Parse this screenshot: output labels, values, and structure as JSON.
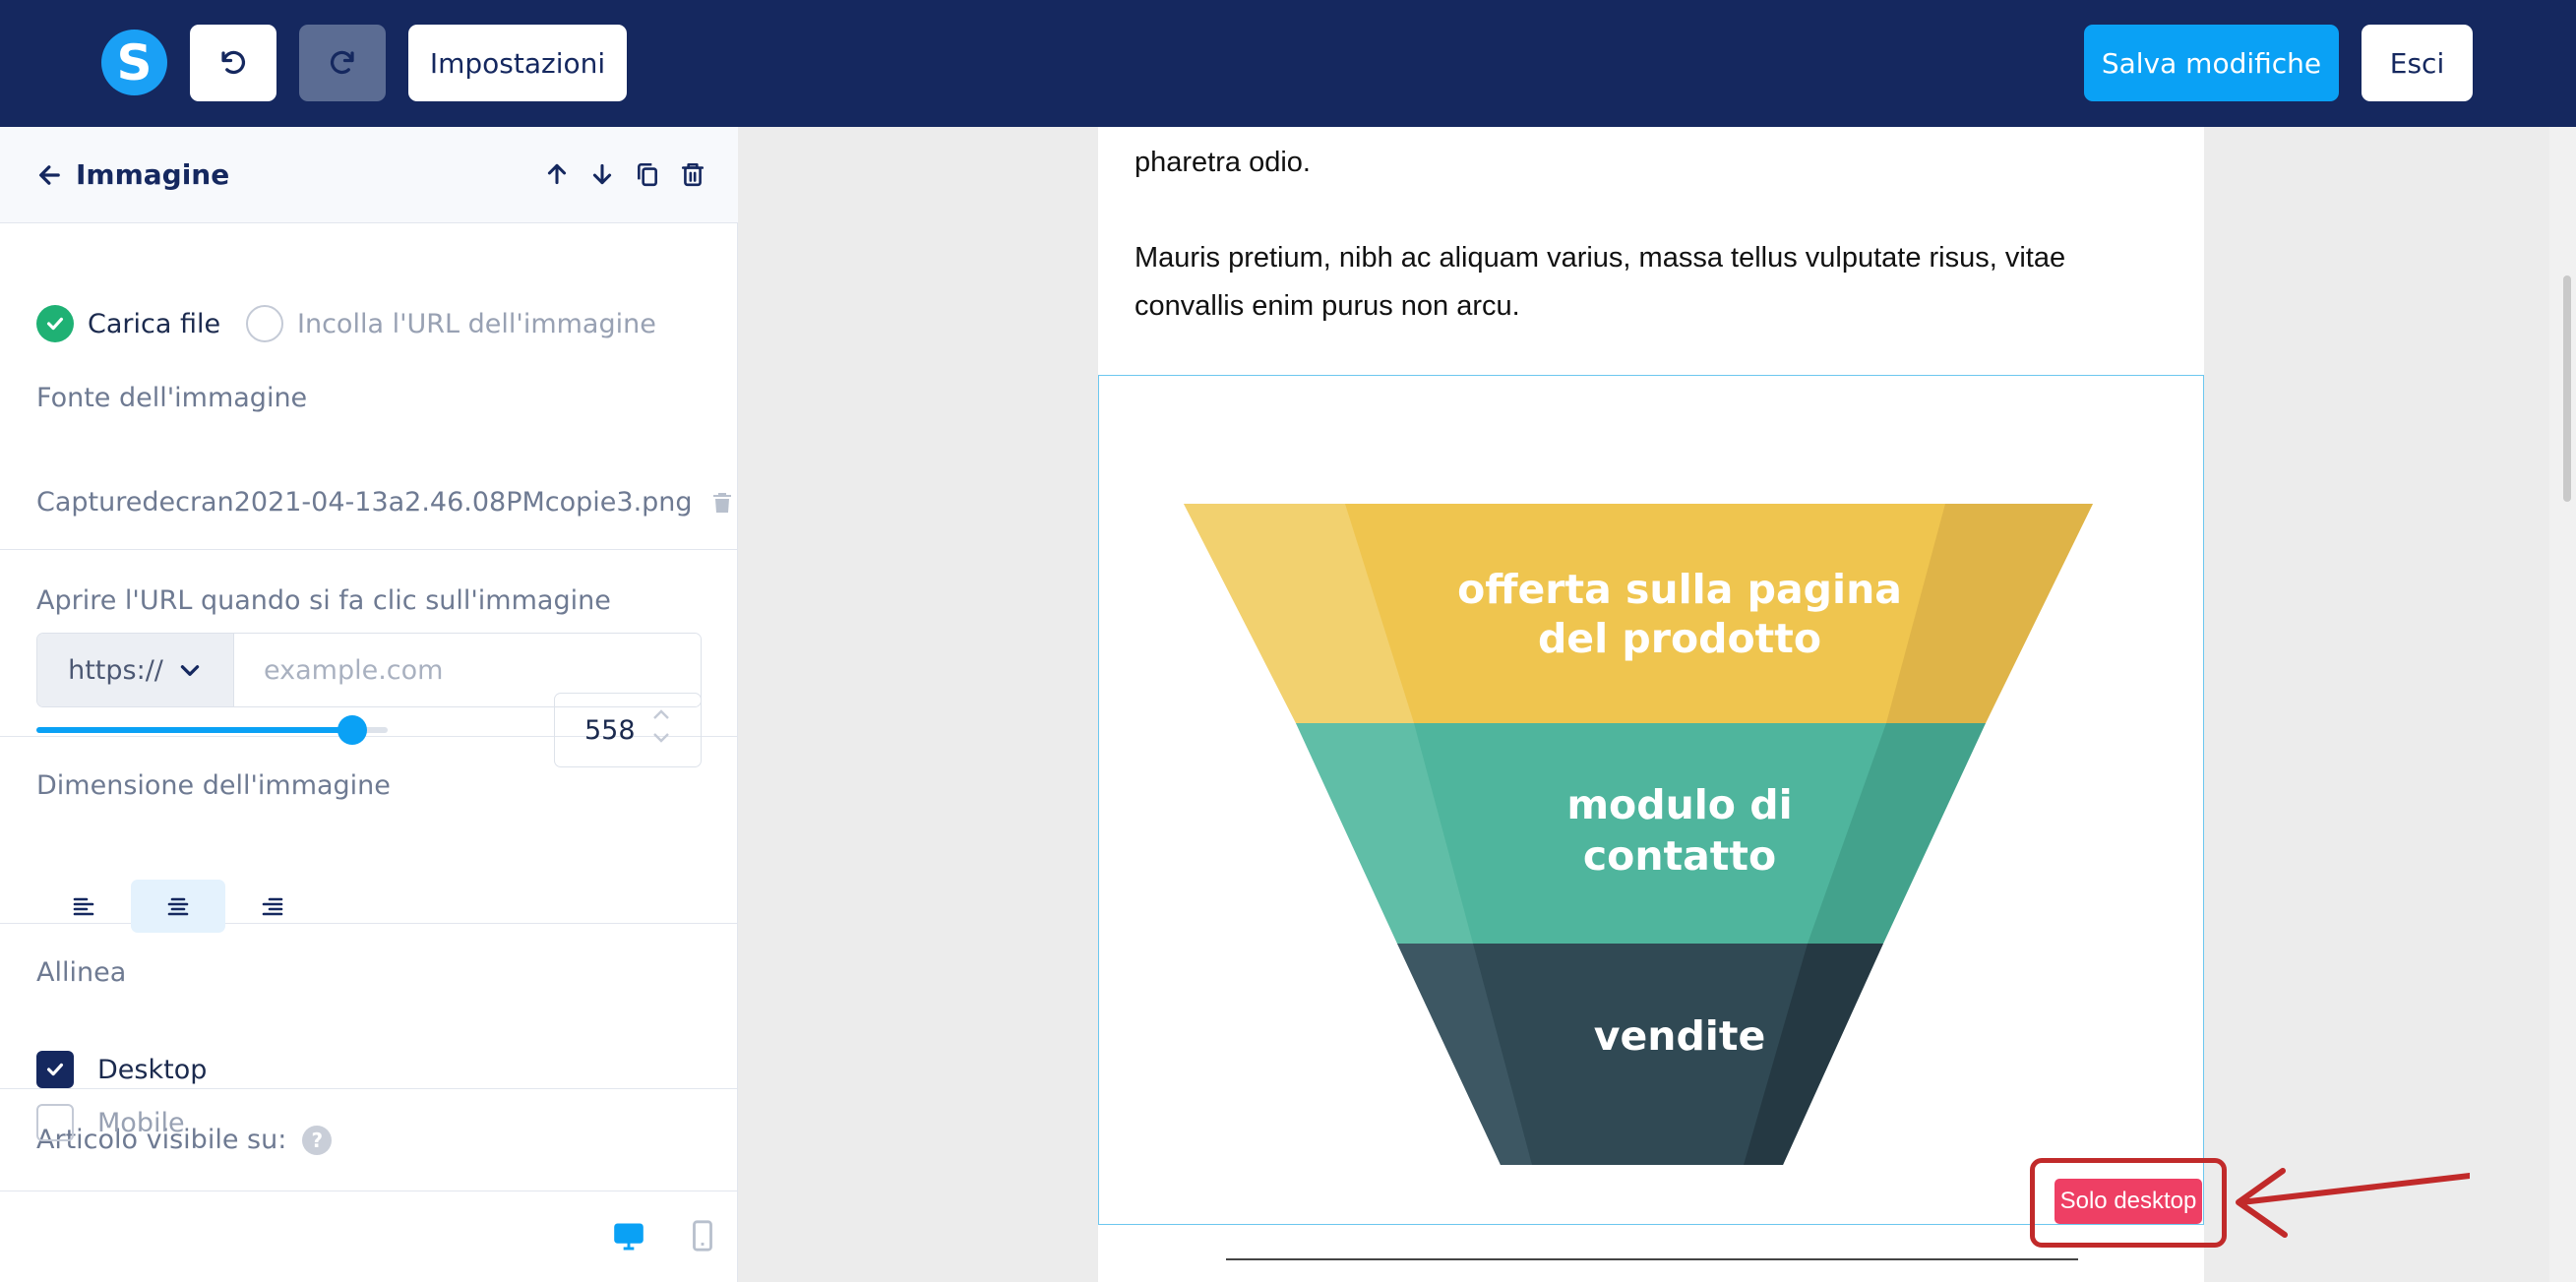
{
  "topbar": {
    "logo_letter": "S",
    "settings_label": "Impostazioni",
    "save_label": "Salva modifiche",
    "exit_label": "Esci"
  },
  "sidebar": {
    "header_title": "Immagine",
    "image_source": {
      "label": "Fonte dell'immagine",
      "option_upload": "Carica file",
      "option_url": "Incolla l'URL dell'immagine",
      "selected": "Carica file",
      "filename": "Capturedecran2021-04-13a2.46.08PMcopie3.png"
    },
    "link": {
      "label": "Aprire l'URL quando si fa clic sull'immagine",
      "protocol": "https://",
      "placeholder": "example.com",
      "value": ""
    },
    "size": {
      "label": "Dimensione dell'immagine",
      "value": "558",
      "slider_fraction": 0.9
    },
    "align": {
      "label": "Allinea",
      "selected": "center"
    },
    "visibility": {
      "label": "Articolo visibile su:",
      "help": "?",
      "desktop_label": "Desktop",
      "desktop_checked": true,
      "mobile_label": "Mobile",
      "mobile_checked": false
    }
  },
  "canvas": {
    "para1": "pharetra odio.",
    "para2": "Mauris pretium, nibh ac aliquam varius, massa tellus vulputate risus, vitae convallis enim purus non arcu.",
    "funnel": {
      "top_line1": "offerta sulla pagina",
      "top_line2": "del prodotto",
      "mid_line1": "modulo di",
      "mid_line2": "contatto",
      "bottom": "vendite"
    },
    "badge": "Solo desktop"
  },
  "colors": {
    "topbar": "#15285f",
    "accent": "#0aa1f5",
    "success": "#1fb174",
    "badge": "#ee3f64",
    "annotation": "#c12a2a",
    "funnel_top": "#efc54f",
    "funnel_mid": "#4fb59d",
    "funnel_bottom": "#304954"
  }
}
